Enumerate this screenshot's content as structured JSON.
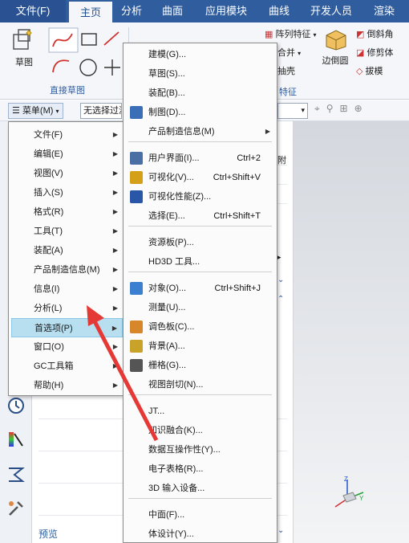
{
  "ribbon_tabs": [
    "文件(F)",
    "主页",
    "分析",
    "曲面",
    "应用模块",
    "曲线",
    "开发人员",
    "渲染"
  ],
  "ribbon": {
    "sketch_label": "草图",
    "group_direct_sketch": "直接草图",
    "group_feature_partial": "特征",
    "array_feature": "阵列特征",
    "merge": "合并",
    "shell": "抽壳",
    "edge_blend": "边倒圆",
    "chamfer": "倒斜角",
    "trim_body": "修剪体",
    "draft": "拔模"
  },
  "toolbar": {
    "menu_button": "菜单(M)",
    "filter_placeholder": "无选择过滤器"
  },
  "nav": {
    "col_attach": "附",
    "preview_label": "预览"
  },
  "main_menu": {
    "items": [
      {
        "label": "文件(F)"
      },
      {
        "label": "编辑(E)"
      },
      {
        "label": "视图(V)"
      },
      {
        "label": "插入(S)"
      },
      {
        "label": "格式(R)"
      },
      {
        "label": "工具(T)"
      },
      {
        "label": "装配(A)"
      },
      {
        "label": "产品制造信息(M)"
      },
      {
        "label": "信息(I)"
      },
      {
        "label": "分析(L)"
      },
      {
        "label": "首选项(P)"
      },
      {
        "label": "窗口(O)"
      },
      {
        "label": "GC工具箱"
      },
      {
        "label": "帮助(H)"
      }
    ]
  },
  "pref_menu": {
    "items": [
      {
        "label": "建模(G)...",
        "shortcut": ""
      },
      {
        "label": "草图(S)...",
        "shortcut": ""
      },
      {
        "label": "装配(B)...",
        "shortcut": ""
      },
      {
        "label": "制图(D)...",
        "shortcut": ""
      },
      {
        "label": "产品制造信息(M)",
        "shortcut": ""
      },
      {
        "label": "用户界面(I)...",
        "shortcut": "Ctrl+2"
      },
      {
        "label": "可视化(V)...",
        "shortcut": "Ctrl+Shift+V"
      },
      {
        "label": "可视化性能(Z)...",
        "shortcut": ""
      },
      {
        "label": "选择(E)...",
        "shortcut": "Ctrl+Shift+T"
      },
      {
        "label": "资源板(P)...",
        "shortcut": ""
      },
      {
        "label": "HD3D 工具...",
        "shortcut": ""
      },
      {
        "label": "对象(O)...",
        "shortcut": "Ctrl+Shift+J"
      },
      {
        "label": "测量(U)...",
        "shortcut": ""
      },
      {
        "label": "调色板(C)...",
        "shortcut": ""
      },
      {
        "label": "背景(A)...",
        "shortcut": ""
      },
      {
        "label": "栅格(G)...",
        "shortcut": ""
      },
      {
        "label": "视图剖切(N)...",
        "shortcut": ""
      },
      {
        "label": "JT...",
        "shortcut": ""
      },
      {
        "label": "知识融合(K)...",
        "shortcut": ""
      },
      {
        "label": "数据互操作性(Y)...",
        "shortcut": ""
      },
      {
        "label": "电子表格(R)...",
        "shortcut": ""
      },
      {
        "label": "3D 输入设备...",
        "shortcut": ""
      },
      {
        "label": "中面(F)...",
        "shortcut": ""
      },
      {
        "label": "体设计(Y)...",
        "shortcut": ""
      }
    ]
  },
  "colors": {
    "ribbon_blue": "#2f5d9e",
    "highlight": "#b7dff0",
    "arrow_red": "#e53935"
  }
}
